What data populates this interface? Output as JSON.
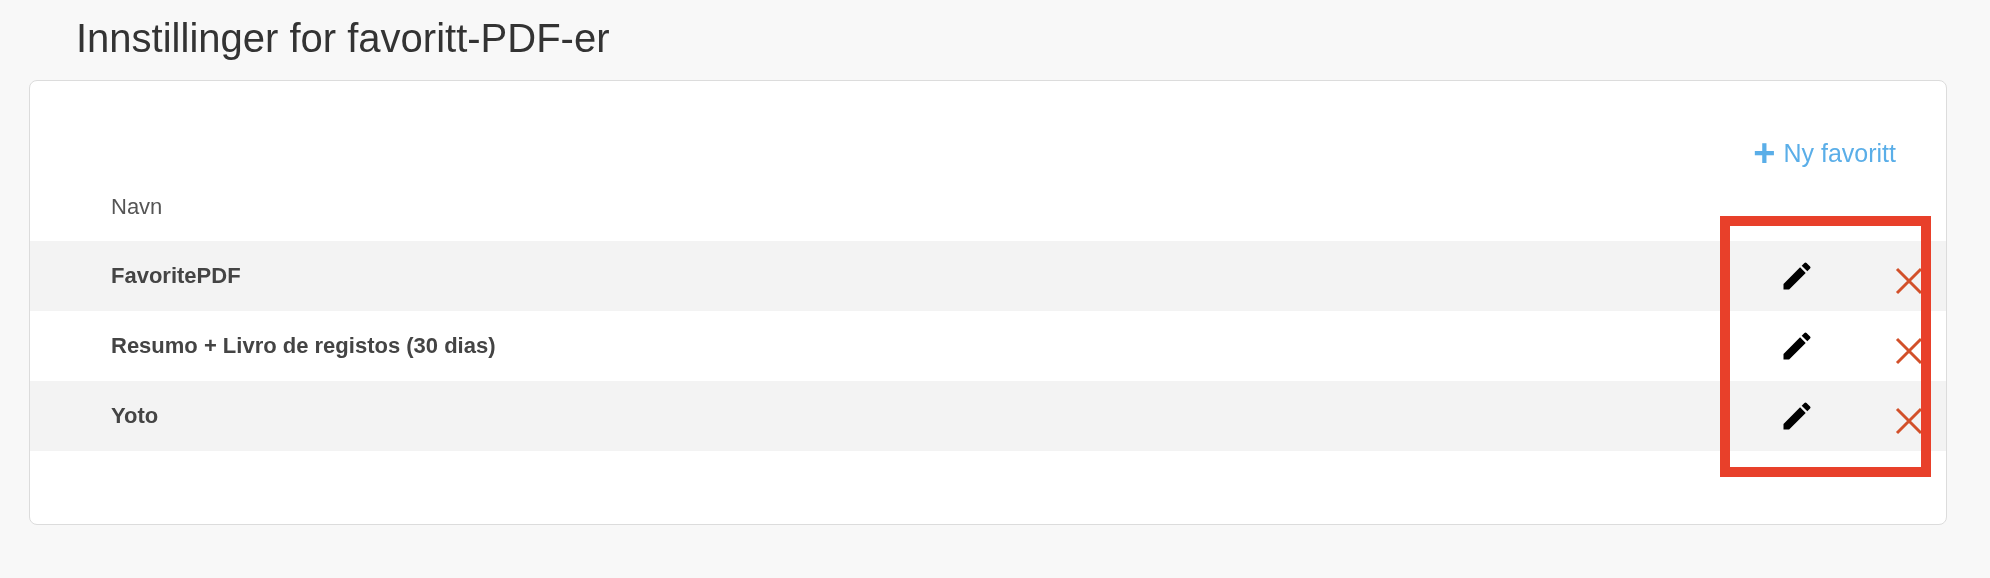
{
  "page": {
    "title": "Innstillinger for favoritt-PDF-er"
  },
  "toolbar": {
    "add_button": {
      "icon": "+",
      "label": "Ny favoritt"
    }
  },
  "table": {
    "columns": [
      "Navn"
    ],
    "rows": [
      {
        "name": "FavoritePDF"
      },
      {
        "name": "Resumo + Livro de registos (30 dias)"
      },
      {
        "name": "Yoto"
      }
    ]
  }
}
